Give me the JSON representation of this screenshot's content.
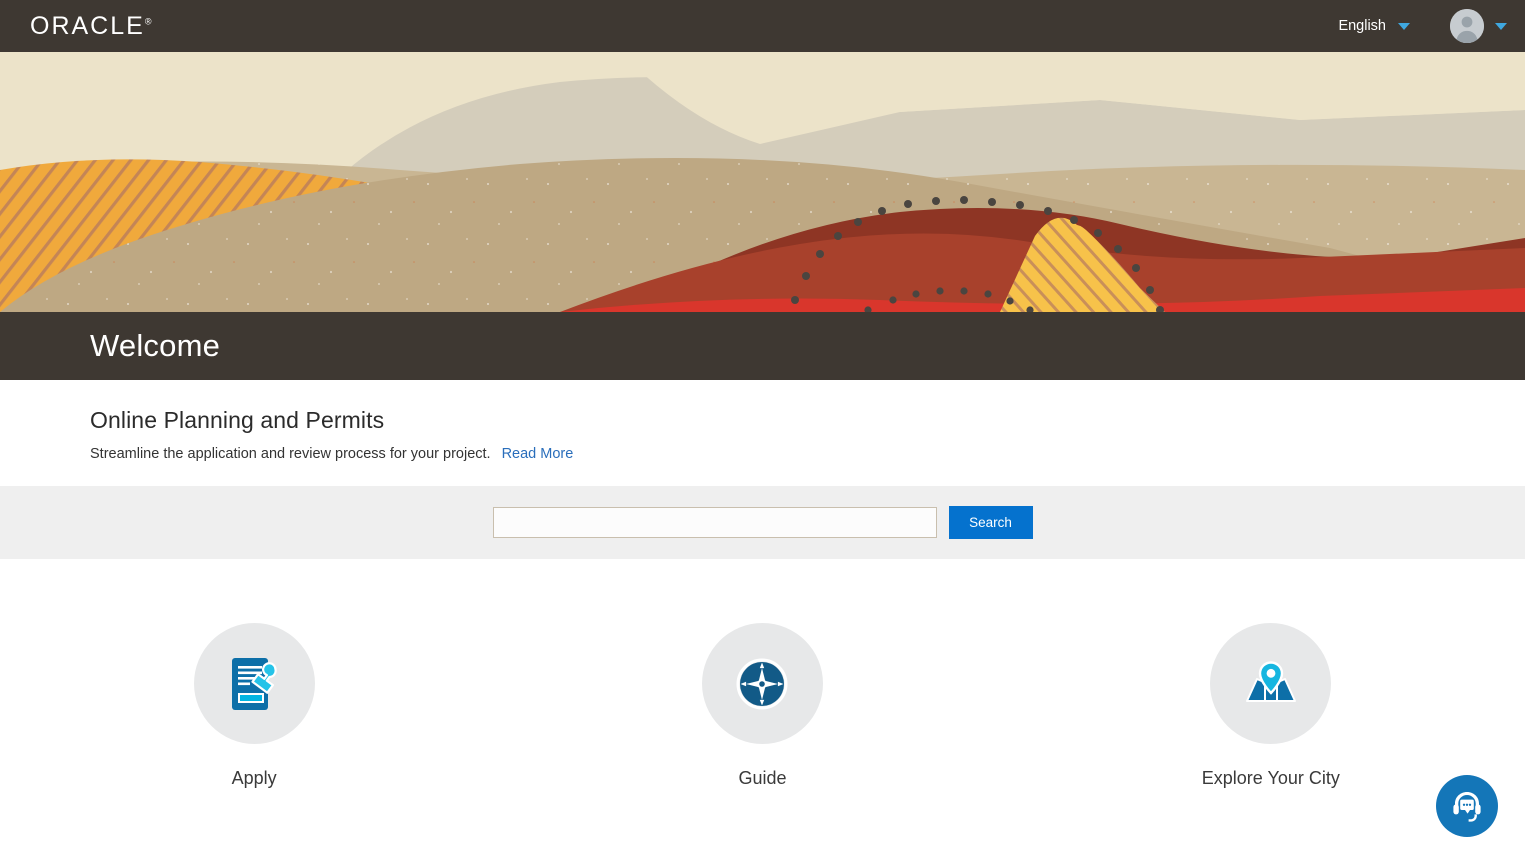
{
  "header": {
    "brand": "ORACLE",
    "brand_mark": "®",
    "language": "English",
    "language_caret_icon": "chevron-down-icon",
    "avatar_icon": "user-avatar-icon",
    "avatar_caret_icon": "chevron-down-icon",
    "background_color": "#3e3832"
  },
  "banner": {
    "alt": "abstract layered mountain landscape illustration",
    "colors": {
      "sky": "#ece3c9",
      "far_ridge": "#cfc8b4",
      "mid_ridge": "#c3aa85",
      "near_ridge": "#bea883",
      "brick": "#a8412c",
      "dark_brick": "#8e3524",
      "red": "#d9362c",
      "yellow": "#f0a93c",
      "yellow_light": "#f7c24a",
      "dots": "#4a4540"
    }
  },
  "welcome": {
    "title": "Welcome",
    "background_color": "#3e3832"
  },
  "intro": {
    "heading": "Online Planning and Permits",
    "description": "Streamline the application and review process for your project.",
    "read_more_label": "Read More",
    "link_color": "#2a6ebb"
  },
  "search": {
    "value": "",
    "placeholder": "",
    "button_label": "Search",
    "button_color": "#0572ce",
    "background_color": "#efefef"
  },
  "tiles": [
    {
      "label": "Apply",
      "icon": "document-stamp-icon"
    },
    {
      "label": "Guide",
      "icon": "compass-icon"
    },
    {
      "label": "Explore Your City",
      "icon": "map-pin-icon"
    }
  ],
  "chat": {
    "icon": "headset-chat-icon",
    "color": "#1476b8"
  }
}
